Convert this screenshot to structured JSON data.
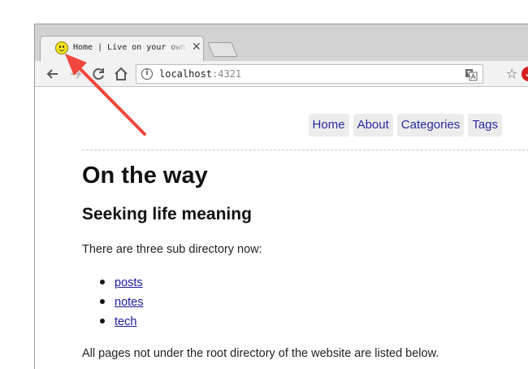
{
  "browser": {
    "tab": {
      "title": "Home | Live on your own way",
      "close_glyph": "✕"
    },
    "toolbar": {
      "back_icon": "arrow-left-icon",
      "reload_icon": "reload-icon",
      "home_icon": "home-icon",
      "url_host": "localhost",
      "url_port": ":4321",
      "star_glyph": "☆",
      "extension_glyph": "✓"
    }
  },
  "page": {
    "nav": [
      {
        "label": "Home"
      },
      {
        "label": "About"
      },
      {
        "label": "Categories"
      },
      {
        "label": "Tags"
      }
    ],
    "title": "On the way",
    "subtitle": "Seeking life meaning",
    "intro": "There are three sub directory now:",
    "directories": [
      {
        "label": "posts"
      },
      {
        "label": "notes"
      },
      {
        "label": "tech"
      }
    ],
    "outro": "All pages not under the root directory of the website are listed below."
  },
  "annotation": {
    "arrow_color": "#f0463c"
  }
}
